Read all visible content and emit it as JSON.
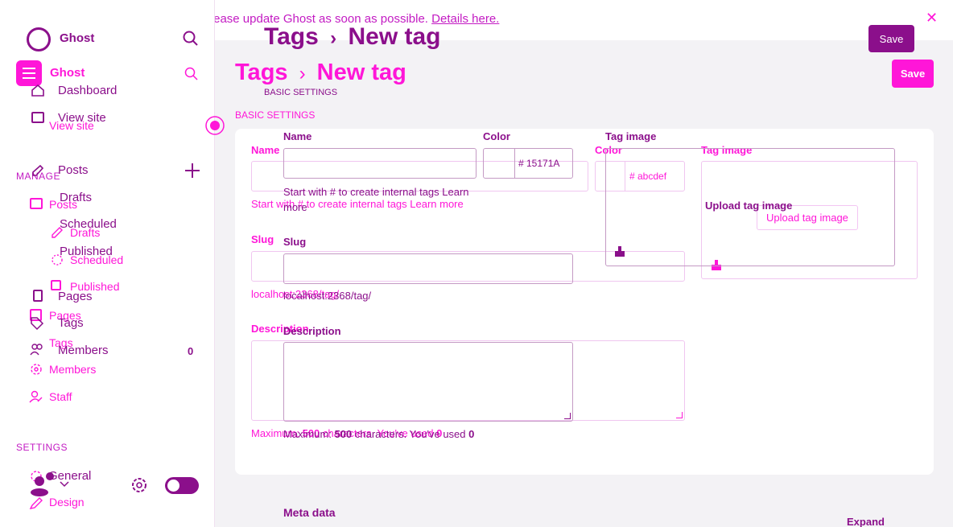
{
  "banner": {
    "text": "Critical security update available — please update Ghost as soon as possible.",
    "link": "Details here."
  },
  "sidebar": {
    "brand_dark": "Ghost",
    "brand_mag": "Ghost",
    "nav_dark": {
      "dashboard": "Dashboard",
      "view_site": "View site",
      "posts": "Posts",
      "drafts": "Drafts",
      "scheduled": "Scheduled",
      "published": "Published",
      "pages": "Pages",
      "tags": "Tags",
      "members": "Members",
      "members_count": "0",
      "general": "General"
    },
    "nav_mag": {
      "view_site": "View site",
      "manage_label": "MANAGE",
      "posts": "Posts",
      "drafts": "Drafts",
      "scheduled": "Scheduled",
      "published": "Published",
      "pages": "Pages",
      "tags": "Tags",
      "members": "Members",
      "staff": "Staff",
      "settings_label": "SETTINGS",
      "general": "General",
      "design": "Design"
    }
  },
  "header": {
    "breadcrumb_parent": "Tags",
    "separator": "›",
    "breadcrumb_current": "New tag",
    "save_label": "Save"
  },
  "basic_settings": {
    "label_dark": "BASIC SETTINGS",
    "label_mag": "BASIC SETTINGS"
  },
  "form_dark": {
    "name_label": "Name",
    "color_label": "Color",
    "color_value": "# 15171A",
    "tag_image_label": "Tag image",
    "name_hint": "Start with # to create internal tags Learn more",
    "upload_label": "Upload tag image",
    "slug_label": "Slug",
    "slug_hint": "localhost:2368/tag/",
    "description_label": "Description",
    "description_hint_prefix": "Maximum: ",
    "description_max": "500",
    "description_hint_mid": " characters. You've used ",
    "description_used": "0"
  },
  "form_mag": {
    "name_label": "Name",
    "color_label": "Color",
    "color_placeholder": "# abcdef",
    "tag_image_label": "Tag image",
    "name_hint": "Start with # to create internal tags Learn more",
    "upload_label": "Upload tag image",
    "slug_label": "Slug",
    "slug_hint": "localhost:2368/tag/",
    "description_label": "Description",
    "description_hint_prefix": "Maximum: ",
    "description_max": "500",
    "description_hint_mid": " characters. You've used ",
    "description_used": "0"
  },
  "meta": {
    "title": "Meta data",
    "expand_label": "Expand"
  },
  "colors": {
    "dark_purple": "#8b0f8b",
    "magenta": "#ff16d8",
    "background": "#f3f2f5"
  }
}
